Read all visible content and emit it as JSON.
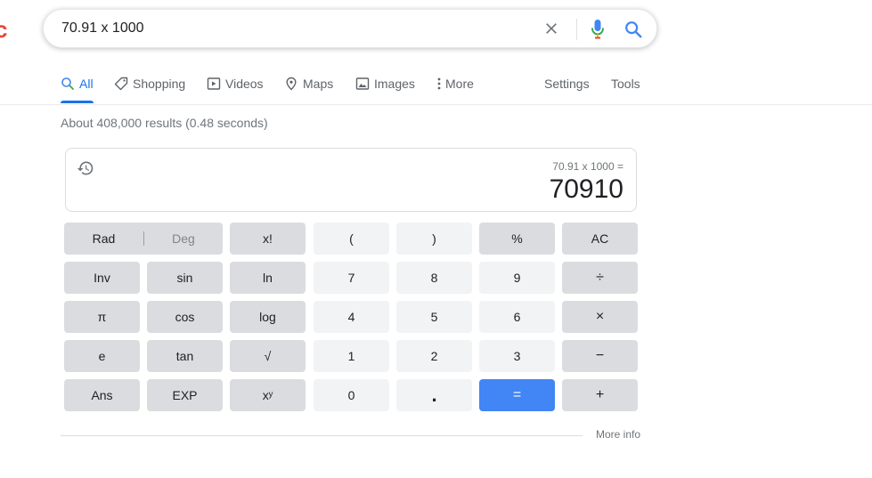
{
  "search": {
    "query": "70.91 x 1000"
  },
  "logo_fragment": "c",
  "nav": {
    "tabs": [
      {
        "label": "All",
        "icon": "search-icon",
        "active": true
      },
      {
        "label": "Shopping",
        "icon": "tag-icon"
      },
      {
        "label": "Videos",
        "icon": "video-icon"
      },
      {
        "label": "Maps",
        "icon": "map-pin-icon"
      },
      {
        "label": "Images",
        "icon": "image-icon"
      },
      {
        "label": "More",
        "icon": "more-vert-icon"
      }
    ],
    "settings": "Settings",
    "tools": "Tools"
  },
  "result_stats": "About 408,000 results (0.48 seconds)",
  "calculator": {
    "expression": "70.91 x 1000 =",
    "result": "70910",
    "rad": "Rad",
    "deg": "Deg",
    "keys": [
      [
        "x!",
        "(",
        ")",
        "%",
        "AC"
      ],
      [
        "Inv",
        "sin",
        "ln",
        "7",
        "8",
        "9",
        "÷"
      ],
      [
        "π",
        "cos",
        "log",
        "4",
        "5",
        "6",
        "×"
      ],
      [
        "e",
        "tan",
        "√",
        "1",
        "2",
        "3",
        "−"
      ],
      [
        "Ans",
        "EXP",
        "xʸ",
        "0",
        ".",
        "=",
        "+"
      ]
    ]
  },
  "more_info": "More info",
  "colors": {
    "accent": "#1a73e8",
    "equals_key": "#4285f4",
    "function_key": "#dadce0",
    "number_key": "#f1f3f4"
  }
}
